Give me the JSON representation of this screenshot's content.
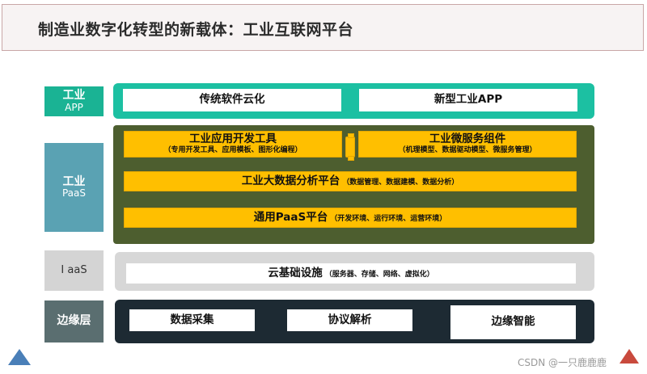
{
  "title": "制造业数字化转型的新载体：工业互联网平台",
  "layers": {
    "app": {
      "l1": "工业",
      "l2": "APP"
    },
    "paas": {
      "l1": "工业",
      "l2": "PaaS"
    },
    "iaas": {
      "l1": "I aaS"
    },
    "edge": {
      "l1": "边缘层"
    }
  },
  "app_boxes": [
    "传统软件云化",
    "新型工业APP"
  ],
  "paas_boxes": {
    "dev_tools": {
      "main": "工业应用开发工具",
      "sub": "（专用开发工具、应用模板、图形化编程）"
    },
    "micro": {
      "main": "工业微服务组件",
      "sub": "（机理模型、数据驱动模型、微服务管理）"
    },
    "bigdata": {
      "main": "工业大数据分析平台",
      "sub": "（数据管理、数据建模、数据分析）"
    },
    "general": {
      "main": "通用PaaS平台",
      "sub": "（开发环境、运行环境、运营环境）"
    }
  },
  "iaas_box": {
    "main": "云基础设施",
    "sub": "（服务器、存储、网络、虚拟化）"
  },
  "edge_boxes": [
    "数据采集",
    "协议解析",
    "边缘智能"
  ],
  "watermark": "CSDN @一只鹿鹿鹿",
  "colors": {
    "app": "#1cc0a2",
    "paas": "#4d5e2f",
    "paas_label": "#5aa2b3",
    "yellow": "#ffbf00",
    "iaas": "#d7d7d7",
    "edge": "#1d2a33"
  }
}
